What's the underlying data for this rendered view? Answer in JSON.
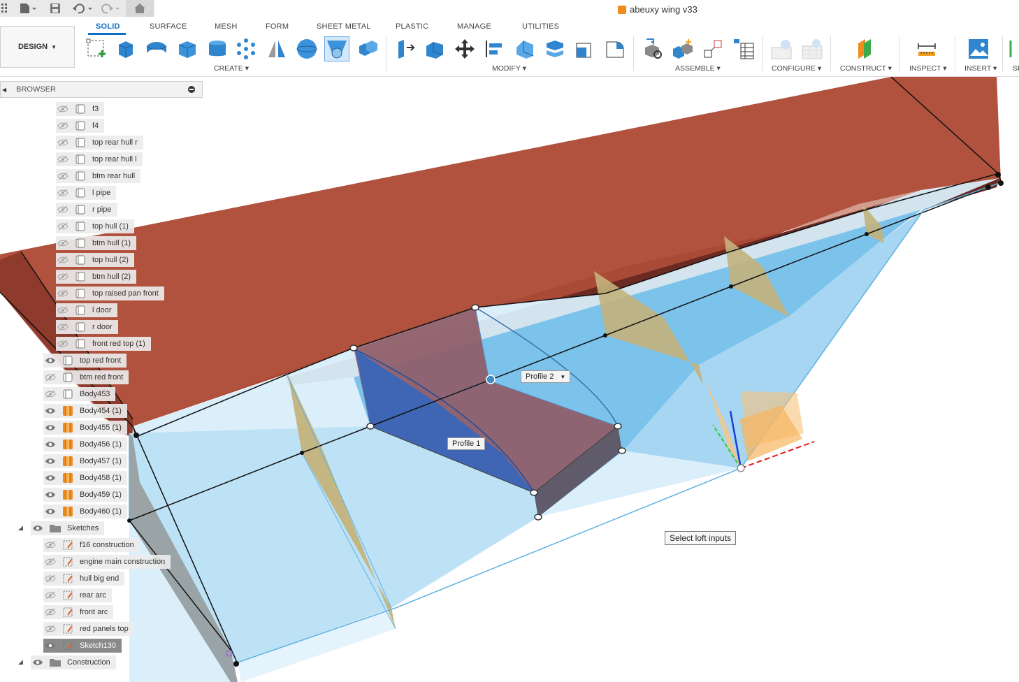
{
  "window": {
    "title": "abeuxy wing v33"
  },
  "workspace_button": {
    "label": "DESIGN"
  },
  "tabs": [
    {
      "label": "SOLID",
      "active": true
    },
    {
      "label": "SURFACE"
    },
    {
      "label": "MESH"
    },
    {
      "label": "FORM"
    },
    {
      "label": "SHEET METAL"
    },
    {
      "label": "PLASTIC"
    },
    {
      "label": "MANAGE"
    },
    {
      "label": "UTILITIES"
    }
  ],
  "groups": {
    "create": "CREATE",
    "modify": "MODIFY",
    "assemble": "ASSEMBLE",
    "configure": "CONFIGURE",
    "construct": "CONSTRUCT",
    "inspect": "INSPECT",
    "insert": "INSERT",
    "select": "SE"
  },
  "browser": {
    "title": "BROWSER",
    "bodies_hidden": [
      "f3",
      "f4",
      "top rear hull r",
      "top rear hull l",
      "btm rear hull",
      "l pipe",
      "r pipe",
      "top hull (1)",
      "btm hull (1)",
      "top hull (2)",
      "btm hull (2)",
      "top raised pan front",
      "l door",
      "r door",
      "front red top (1)"
    ],
    "bodies_main": [
      "top red front",
      "btm red front",
      "Body453",
      "Body454 (1)",
      "Body455 (1)",
      "Body456 (1)",
      "Body457 (1)",
      "Body458 (1)",
      "Body459 (1)",
      "Body460 (1)"
    ],
    "sketches_folder": "Sketches",
    "sketches": [
      "f16 construction",
      "engine main construction",
      "hull big end",
      "rear arc",
      "front arc",
      "red panels top",
      "Sketch130"
    ],
    "construction_folder": "Construction"
  },
  "viewport": {
    "profile2": "Profile 2",
    "profile1": "Profile 1",
    "status_tip": "Select loft inputs"
  },
  "colors": {
    "accent": "#0b6fc5",
    "red_body": "#a84a37",
    "blue_body": "#7cc3ec",
    "rib": "#c3b37c"
  }
}
